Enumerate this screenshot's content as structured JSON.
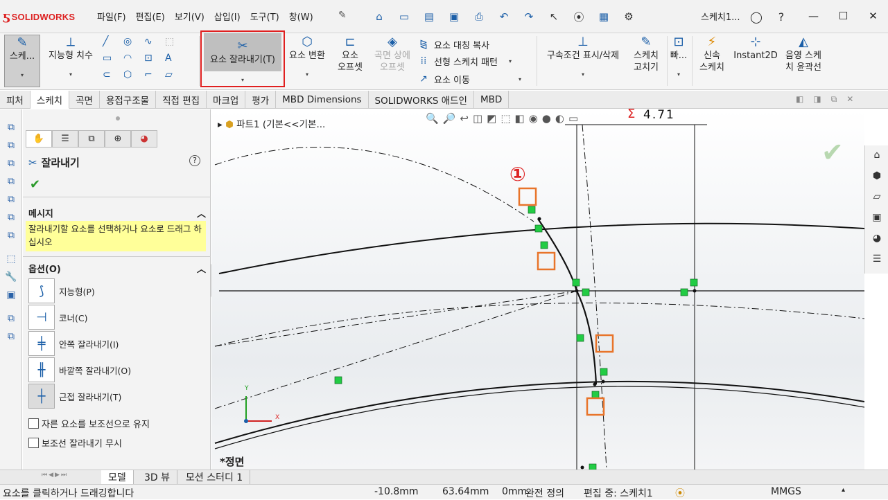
{
  "app": {
    "logo_text": "SOLIDWORKS",
    "doc_title": "스케치1..."
  },
  "menu": [
    "파일(F)",
    "편집(E)",
    "보기(V)",
    "삽입(I)",
    "도구(T)",
    "창(W)"
  ],
  "ribbon": {
    "sketch": "스케...",
    "smart_dim": "지능형 치수",
    "trim": "요소 잘라내기(T)",
    "convert": "요소 변환",
    "offset": "요소\n오프셋",
    "surface_offset": "곡면 상에\n오프셋",
    "mirror": "요소 대칭 복사",
    "linear_pattern": "선형 스케치 패턴",
    "move": "요소 이동",
    "relations": "구속조건 표시/삭제",
    "repair": "스케치\n고치기",
    "quick": "빠...",
    "rapid": "신속\n스케치",
    "instant2d": "Instant2D",
    "shaded": "음영 스케\n치 윤곽선"
  },
  "tabs": [
    "피처",
    "스케치",
    "곡면",
    "용접구조물",
    "직접 편집",
    "마크업",
    "평가",
    "MBD Dimensions",
    "SOLIDWORKS 애드인",
    "MBD"
  ],
  "pm": {
    "title": "잘라내기",
    "msg_header": "메시지",
    "msg": "잘라내기할 요소를 선택하거나 요소로 드래그 하십시오",
    "opt_header": "옵션(O)",
    "options": [
      "지능형(P)",
      "코너(C)",
      "안쪽 잘라내기(I)",
      "바깥쪽 잘라내기(O)",
      "근접 잘라내기(T)"
    ],
    "check1": "자른 요소를 보조선으로 유지",
    "check2": "보조선 잘라내기 무시"
  },
  "tree": "파트1  (기본<<기본...",
  "canvas": {
    "dim": "4.71",
    "marker": "①",
    "view": "*정면",
    "axis_x": "X",
    "axis_y": "Y"
  },
  "bottom_tabs": [
    "모델",
    "3D 뷰",
    "모션 스터디 1"
  ],
  "status": {
    "hint": "요소를 클릭하거나 드래깅합니다",
    "x": "-10.8mm",
    "y": "63.64mm",
    "z": "0mm",
    "state": "완전 정의",
    "edit": "편집 중: 스케치1",
    "units": "MMGS"
  },
  "colors": {
    "accent": "#d22222",
    "highlight": "#ffff99",
    "point": "#22cc44",
    "marker": "#e8742a"
  }
}
